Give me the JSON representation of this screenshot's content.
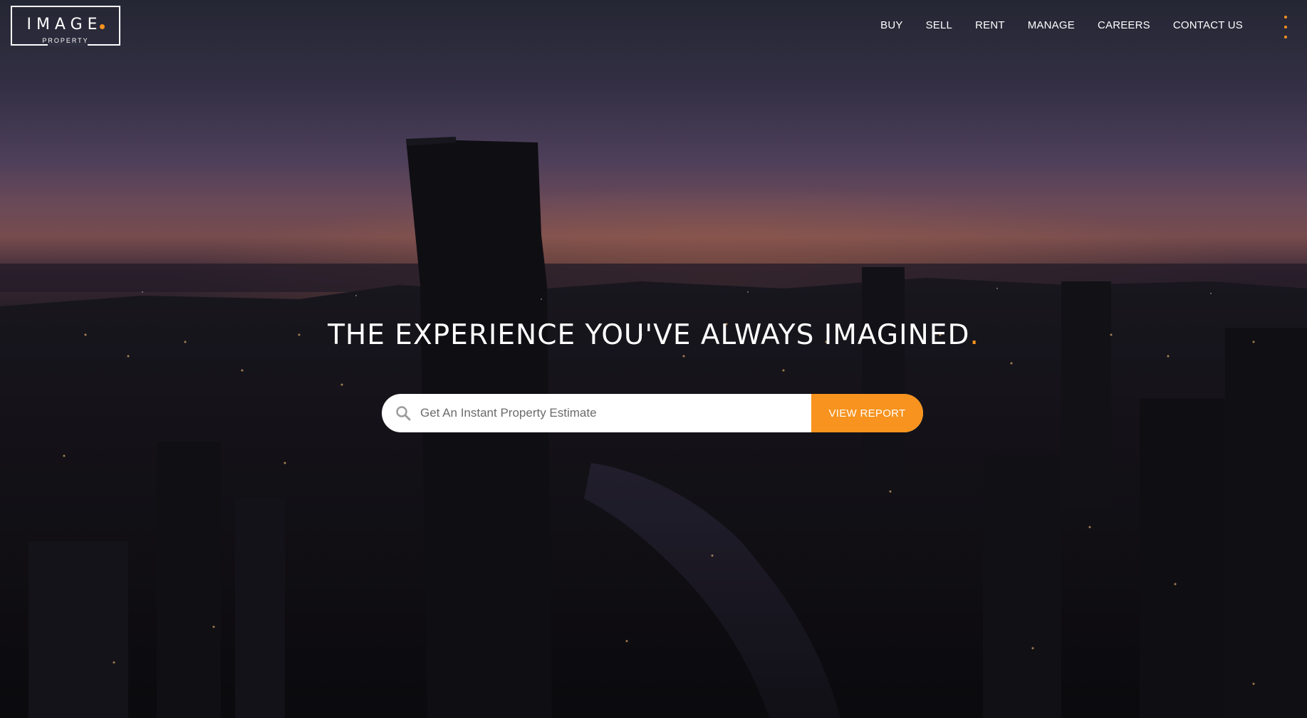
{
  "brand": {
    "logo_text": "IMAGE",
    "logo_subtext": "PROPERTY",
    "accent_color": "#f7931e"
  },
  "nav": {
    "items": [
      {
        "label": "BUY"
      },
      {
        "label": "SELL"
      },
      {
        "label": "RENT"
      },
      {
        "label": "MANAGE"
      },
      {
        "label": "CAREERS"
      },
      {
        "label": "CONTACT US"
      }
    ],
    "menu_icon": "vertical-dots-menu-icon"
  },
  "hero": {
    "headline": "THE EXPERIENCE YOU'VE ALWAYS IMAGINED",
    "headline_dot": ".",
    "search": {
      "placeholder": "Get An Instant Property Estimate",
      "value": "",
      "icon": "search-icon",
      "button_label": "VIEW REPORT"
    }
  }
}
